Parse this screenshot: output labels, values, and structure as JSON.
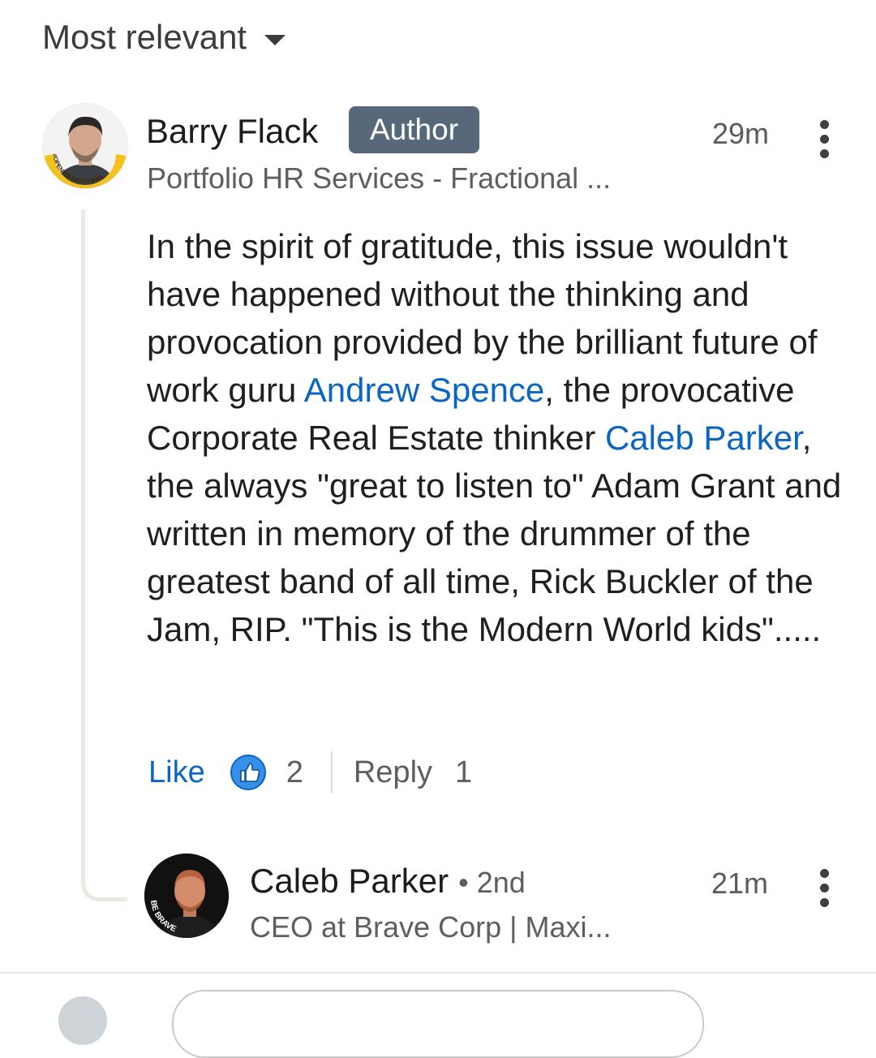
{
  "sort": {
    "label": "Most relevant"
  },
  "comments": [
    {
      "name": "Barry Flack",
      "badge": "Author",
      "time": "29m",
      "headline": "Portfolio HR Services - Fractional ...",
      "avatar_ring_text": "#OPENTOFRACTIONAL",
      "body": [
        {
          "text": "In the spirit of gratitude, this issue wouldn't have happened without the thinking and provocation provided by the brilliant future of work guru "
        },
        {
          "text": "Andrew Spence",
          "mention": true
        },
        {
          "text": ", the provocative Corporate Real Estate thinker "
        },
        {
          "text": "Caleb Parker",
          "mention": true
        },
        {
          "text": ", the always \"great to listen to\" Adam Grant and written in memory of the drummer of the greatest band of all time, Rick Buckler of the Jam, RIP. \"This is the Modern World kids\"....."
        }
      ],
      "like_label": "Like",
      "like_count": "2",
      "reply_label": "Reply",
      "reply_count": "1"
    },
    {
      "name": "Caleb Parker",
      "degree": "• 2nd",
      "time": "21m",
      "headline": "CEO at Brave Corp | Maxi...",
      "avatar_ring_text": "BE BRAVE"
    }
  ],
  "colors": {
    "accent": "#0a66c2",
    "badge_bg": "#56687a"
  }
}
